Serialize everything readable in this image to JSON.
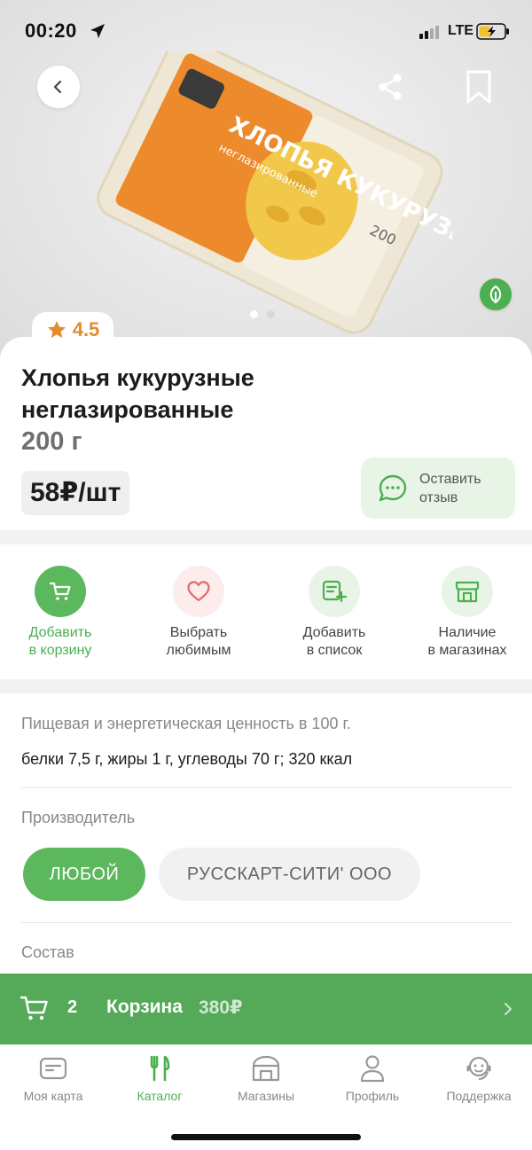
{
  "status_bar": {
    "time": "00:20",
    "network": "LTE"
  },
  "colors": {
    "brand_green": "#4caf50",
    "rating_orange": "#e58a2e",
    "cart_bar": "#54aa59"
  },
  "product": {
    "rating": "4.5",
    "title": "Хлопья кукурузные неглазированные",
    "weight": "200 г",
    "price": "58₽/шт",
    "review_button": "Оставить\nотзыв",
    "pack_brand": "ХЛОПЬЯ КУКУРУЗНЫЕ",
    "pack_sub": "неглазированные",
    "pack_weight": "200"
  },
  "actions": [
    {
      "label": "Добавить\nв корзину",
      "icon": "cart-icon"
    },
    {
      "label": "Выбрать\nлюбимым",
      "icon": "heart-icon"
    },
    {
      "label": "Добавить\nв список",
      "icon": "list-add-icon"
    },
    {
      "label": "Наличие\nв магазинах",
      "icon": "store-icon"
    }
  ],
  "details": {
    "nutrition_label": "Пищевая и энергетическая ценность в 100 г.",
    "nutrition_value": "белки 7,5 г, жиры 1 г, углеводы 70 г; 320 ккал",
    "manufacturer_label": "Производитель",
    "manufacturer_options": [
      "ЛЮБОЙ",
      "РУССКАРТ-СИТИ' ООО"
    ],
    "composition_label": "Состав"
  },
  "cart": {
    "count": "2",
    "label": "Корзина",
    "sum": "380₽"
  },
  "tabs": [
    {
      "label": "Моя карта",
      "icon": "card-icon"
    },
    {
      "label": "Каталог",
      "icon": "catalog-icon"
    },
    {
      "label": "Магазины",
      "icon": "shops-icon"
    },
    {
      "label": "Профиль",
      "icon": "profile-icon"
    },
    {
      "label": "Поддержка",
      "icon": "support-icon"
    }
  ]
}
